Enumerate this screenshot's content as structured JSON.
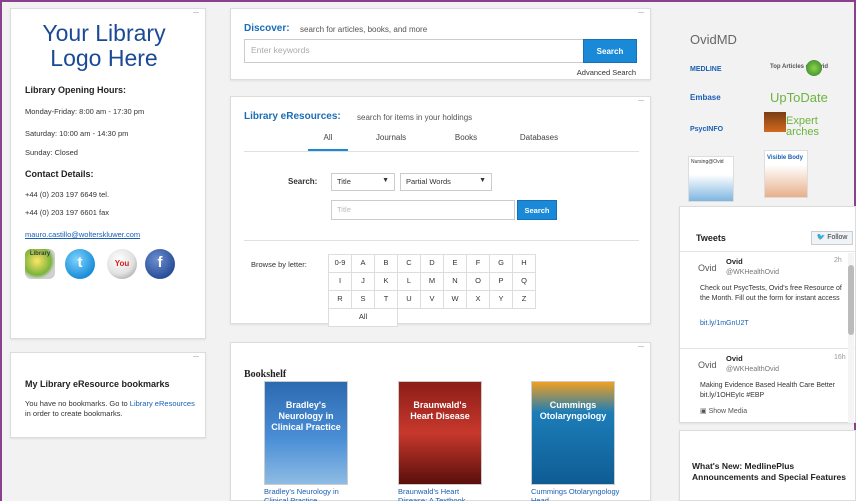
{
  "library": {
    "logo_line1": "Your Library",
    "logo_line2": "Logo Here",
    "hours_title": "Library Opening Hours:",
    "hours": [
      "Monday-Friday: 8:00 am - 17:30 pm",
      "Saturday: 10:00 am - 14:30 pm",
      "Sunday: Closed"
    ],
    "contact_title": "Contact Details:",
    "tel": "+44 (0) 203 197 6649 tel.",
    "fax": "+44 (0) 203 197 6601 fax",
    "email": "mauro.castillo@wolterskluwer.com",
    "social_icons": [
      "books-icon",
      "twitter-icon",
      "youtube-icon",
      "facebook-icon"
    ]
  },
  "bookmarks": {
    "title": "My Library eResource bookmarks",
    "text_before": "You have no bookmarks. Go to ",
    "link": "Library eResources",
    "text_after": " in order to create bookmarks."
  },
  "discover": {
    "title": "Discover:",
    "subtitle": "search for articles, books, and more",
    "placeholder": "Enter keywords",
    "button": "Search",
    "advanced": "Advanced Search"
  },
  "eresources": {
    "title": "Library eResources:",
    "subtitle": "search for items in your holdings",
    "tabs": [
      "All",
      "Journals",
      "Books",
      "Databases"
    ],
    "search_label": "Search:",
    "type_select": "Title",
    "mode_select": "Partial Words",
    "title_placeholder": "Title",
    "button": "Search",
    "browse_label": "Browse by letter:",
    "letters": [
      "0-9",
      "A",
      "B",
      "C",
      "D",
      "E",
      "F",
      "G",
      "H",
      "I",
      "J",
      "K",
      "L",
      "M",
      "N",
      "O",
      "P",
      "Q",
      "R",
      "S",
      "T",
      "U",
      "V",
      "W",
      "X",
      "Y",
      "Z",
      "All"
    ]
  },
  "bookshelf": {
    "title": "Bookshelf",
    "books": [
      {
        "cover": "Bradley's Neurology in Clinical Practice",
        "caption": "Bradley's Neurology in Clinical Practice"
      },
      {
        "cover": "Braunwald's Heart Disease",
        "caption": "Braunwald's Heart Disease: A Textbook"
      },
      {
        "cover": "Cummings Otolaryngology",
        "caption": "Cummings Otolaryngology Head"
      }
    ]
  },
  "vendors": {
    "ovid_md": "OvidMD",
    "medline": "MEDLINE",
    "top_articles": "Top Articles on Ovid",
    "embase": "Embase",
    "uptodate": "UpToDate",
    "psycinfo": "PsycINFO",
    "expert_line1": "Expert",
    "expert_line2": "arches",
    "nursing": "Nursing@Ovid",
    "visible_body": "Visible Body"
  },
  "tweets": {
    "title": "Tweets",
    "follow": "Follow",
    "items": [
      {
        "avatar": "Ovid",
        "name": "Ovid",
        "handle": "@WKHealthOvid",
        "time": "2h",
        "text": "Check out PsycTests, Ovid's free Resource of the Month. Fill out the form for instant access",
        "link": "bit.ly/1mGnU2T"
      },
      {
        "avatar": "Ovid",
        "name": "Ovid",
        "handle": "@WKHealthOvid",
        "time": "16h",
        "text": "Making Evidence Based Health Care Better bit.ly/1OHEyIc #EBP",
        "media": "Show Media"
      }
    ]
  },
  "whatsnew": {
    "title": "What's New: MedlinePlus Announcements and Special Features"
  }
}
